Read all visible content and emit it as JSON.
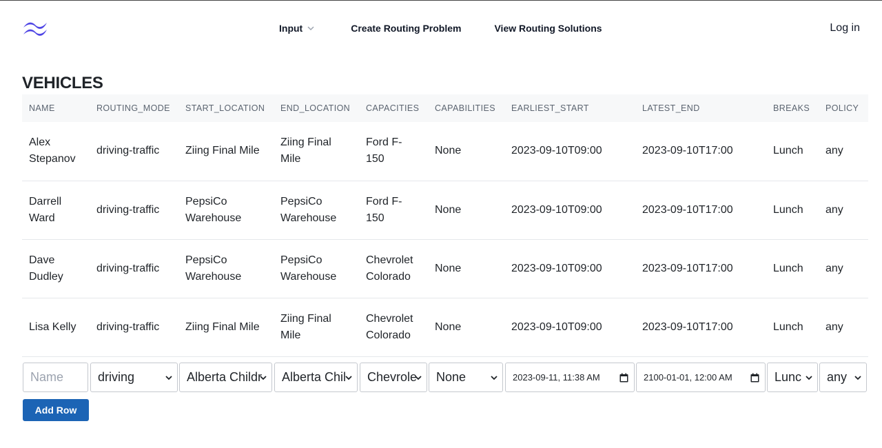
{
  "nav": {
    "logo": "tailwind-logo-icon",
    "items": [
      {
        "label": "Input"
      },
      {
        "label": "Create Routing Problem"
      },
      {
        "label": "View Routing Solutions"
      }
    ],
    "login": "Log in"
  },
  "page": {
    "title": "VEHICLES"
  },
  "table": {
    "headers": [
      "NAME",
      "ROUTING_MODE",
      "START_LOCATION",
      "END_LOCATION",
      "CAPACITIES",
      "CAPABILITIES",
      "EARLIEST_START",
      "LATEST_END",
      "BREAKS",
      "POLICY"
    ],
    "rows": [
      [
        "Alex Stepanov",
        "driving-traffic",
        "Ziing Final Mile",
        "Ziing Final Mile",
        "Ford F-150",
        "None",
        "2023-09-10T09:00",
        "2023-09-10T17:00",
        "Lunch",
        "any"
      ],
      [
        "Darrell Ward",
        "driving-traffic",
        "PepsiCo Warehouse",
        "PepsiCo Warehouse",
        "Ford F-150",
        "None",
        "2023-09-10T09:00",
        "2023-09-10T17:00",
        "Lunch",
        "any"
      ],
      [
        "Dave Dudley",
        "driving-traffic",
        "PepsiCo Warehouse",
        "PepsiCo Warehouse",
        "Chevrolet Colorado",
        "None",
        "2023-09-10T09:00",
        "2023-09-10T17:00",
        "Lunch",
        "any"
      ],
      [
        "Lisa Kelly",
        "driving-traffic",
        "Ziing Final Mile",
        "Ziing Final Mile",
        "Chevrolet Colorado",
        "None",
        "2023-09-10T09:00",
        "2023-09-10T17:00",
        "Lunch",
        "any"
      ]
    ]
  },
  "form": {
    "name_placeholder": "Name",
    "routing_mode": "driving",
    "start_location": "Alberta Childr",
    "end_location": "Alberta Chil",
    "capacities": "Chevrole",
    "capabilities": "None",
    "earliest_start": "2023-09-11, 11:38 AM",
    "latest_end": "2100-01-01, 12:00 AM",
    "breaks": "Lunc",
    "policy": "any",
    "add_row": "Add Row"
  },
  "colors": {
    "accent": "#1c64b5",
    "logo": "#4f46e5"
  }
}
